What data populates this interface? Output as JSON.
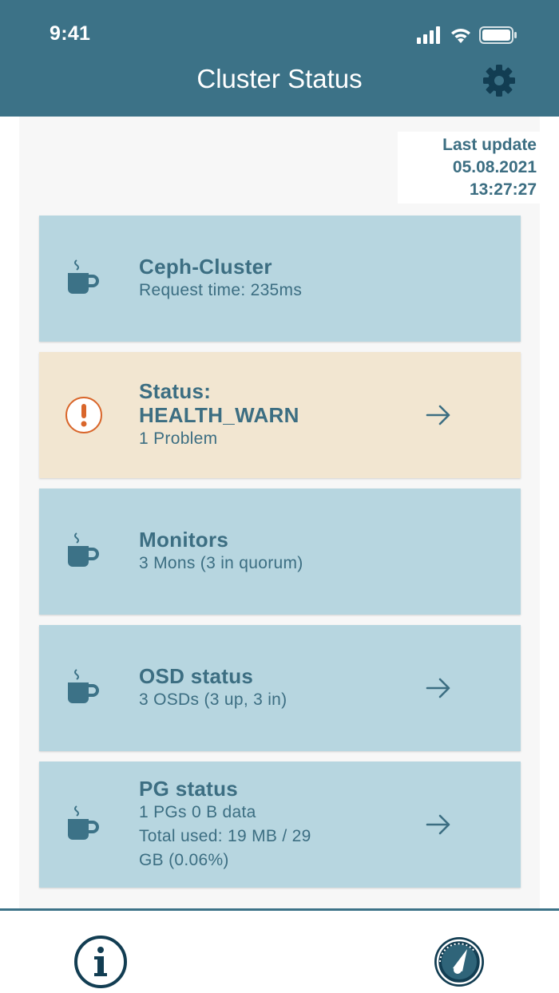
{
  "status_bar": {
    "time": "9:41"
  },
  "header": {
    "title": "Cluster Status"
  },
  "last_update": {
    "label": "Last update",
    "date": "05.08.2021",
    "time": "13:27:27"
  },
  "cards": [
    {
      "title": "Ceph-Cluster",
      "lines": [
        "Request time: 235ms"
      ],
      "icon": "coffee-cup-icon",
      "has_arrow": false
    },
    {
      "title": "Status:",
      "title2": "HEALTH_WARN",
      "lines": [
        "1 Problem"
      ],
      "icon": "warning-exclamation-icon",
      "has_arrow": true
    },
    {
      "title": "Monitors",
      "lines": [
        "3 Mons (3 in quorum)"
      ],
      "icon": "coffee-cup-icon",
      "has_arrow": false
    },
    {
      "title": "OSD status",
      "lines": [
        "3 OSDs (3 up, 3 in)"
      ],
      "icon": "coffee-cup-icon",
      "has_arrow": true
    },
    {
      "title": "PG status",
      "lines": [
        "1 PGs 0 B data",
        "Total used: 19 MB / 29",
        "GB (0.06%)"
      ],
      "icon": "coffee-cup-icon",
      "has_arrow": true
    }
  ],
  "bottom_bar": {
    "left_icon": "info-icon",
    "right_icon": "gauge-icon"
  },
  "colors": {
    "primary": "#3c7287",
    "card_bg": "#b7d6e0",
    "warn_bg": "#f2e6d1",
    "warn_accent": "#d9662b",
    "text": "#3c6e82"
  }
}
